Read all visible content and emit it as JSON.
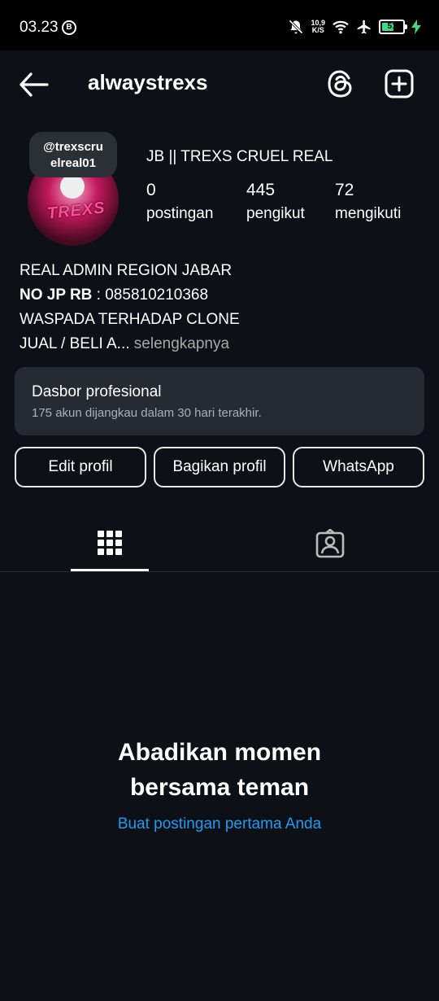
{
  "status_bar": {
    "time": "03.23",
    "b_badge": "B",
    "net_speed_value": "10,9",
    "net_speed_unit": "K/S",
    "battery_level": "51",
    "icons": [
      "bell-off-icon",
      "wifi-icon",
      "airplane-icon",
      "battery-icon",
      "charging-bolt-icon"
    ]
  },
  "header": {
    "username": "alwaystrexs",
    "icons": [
      "back-arrow-icon",
      "threads-icon",
      "add-post-icon"
    ]
  },
  "profile": {
    "note_line1": "@trexscru",
    "note_line2": "elreal01",
    "avatar_text": "TREXS",
    "display_name": "JB || TREXS CRUEL REAL",
    "stats": [
      {
        "value": "0",
        "label": "postingan"
      },
      {
        "value": "445",
        "label": "pengikut"
      },
      {
        "value": "72",
        "label": "mengikuti"
      }
    ],
    "bio": {
      "line1": "REAL ADMIN REGION JABAR",
      "line2_bold": "NO JP RB",
      "line2_rest": " : 085810210368",
      "line3": "WASPADA TERHADAP CLONE",
      "line4": "JUAL / BELI A...",
      "more": " selengkapnya"
    }
  },
  "dashboard": {
    "title": "Dasbor profesional",
    "subtitle": "175 akun dijangkau dalam 30 hari terakhir."
  },
  "buttons": {
    "edit": "Edit profil",
    "share": "Bagikan profil",
    "whatsapp": "WhatsApp"
  },
  "tabs": {
    "icons": [
      "grid-icon",
      "tagged-person-icon"
    ],
    "active": "grid"
  },
  "empty_state": {
    "title_line1": "Abadikan momen",
    "title_line2": "bersama teman",
    "link": "Buat postingan pertama Anda"
  },
  "colors": {
    "background": "#0d1117",
    "card": "#262b33",
    "link": "#1f9bf0",
    "battery": "#3ddc84"
  }
}
